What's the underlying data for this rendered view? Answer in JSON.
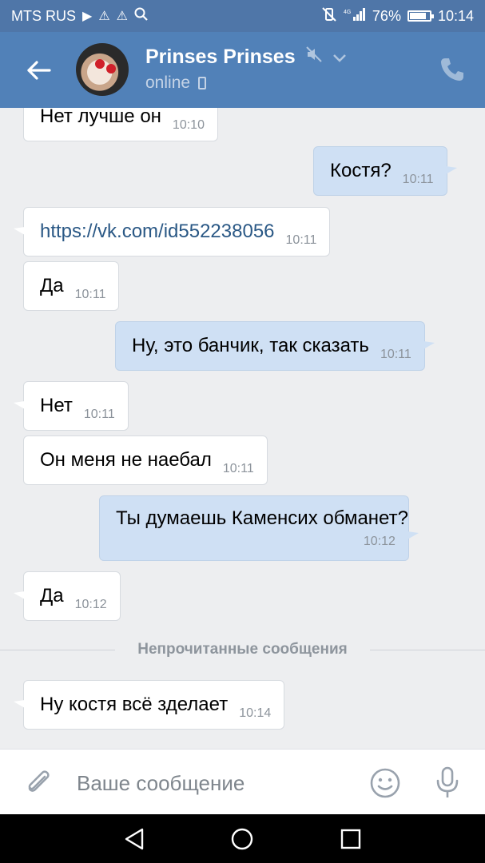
{
  "status_bar": {
    "carrier": "MTS RUS",
    "battery_percent_text": "76%",
    "battery_level": 0.76,
    "time": "10:14"
  },
  "header": {
    "title": "Prinses Prinses",
    "status": "online"
  },
  "messages": [
    {
      "dir": "in",
      "text": "Нет лучше он",
      "time": "10:10"
    },
    {
      "dir": "out",
      "text": "Костя?",
      "time": "10:11"
    },
    {
      "dir": "in",
      "text": "https://vk.com/id552238056",
      "time": "10:11",
      "is_link": true
    },
    {
      "dir": "in",
      "text": "Да",
      "time": "10:11"
    },
    {
      "dir": "out",
      "text": "Ну, это банчик, так сказать",
      "time": "10:11"
    },
    {
      "dir": "in",
      "text": "Нет",
      "time": "10:11"
    },
    {
      "dir": "in",
      "text": "Он меня не наебал",
      "time": "10:11"
    },
    {
      "dir": "out",
      "text": "Ты думаешь Каменсих обманет?",
      "time": "10:12"
    },
    {
      "dir": "in",
      "text": "Да",
      "time": "10:12"
    },
    {
      "dir": "in",
      "text": "Ну костя всё зделает",
      "time": "10:14"
    }
  ],
  "unread_divider": "Непрочитанные сообщения",
  "composer": {
    "placeholder": "Ваше сообщение"
  },
  "icons": {
    "back": "arrow-left-icon",
    "mute": "muted-speaker-icon",
    "call": "phone-icon",
    "attach": "paperclip-icon",
    "emoji": "smiley-icon",
    "mic": "microphone-icon"
  },
  "colors": {
    "header_bg": "#5181b8",
    "status_bg": "#4f76a8",
    "outgoing_bubble": "#cfe0f4",
    "incoming_bubble": "#ffffff",
    "chat_bg": "#edeef0",
    "link": "#2a5885"
  }
}
